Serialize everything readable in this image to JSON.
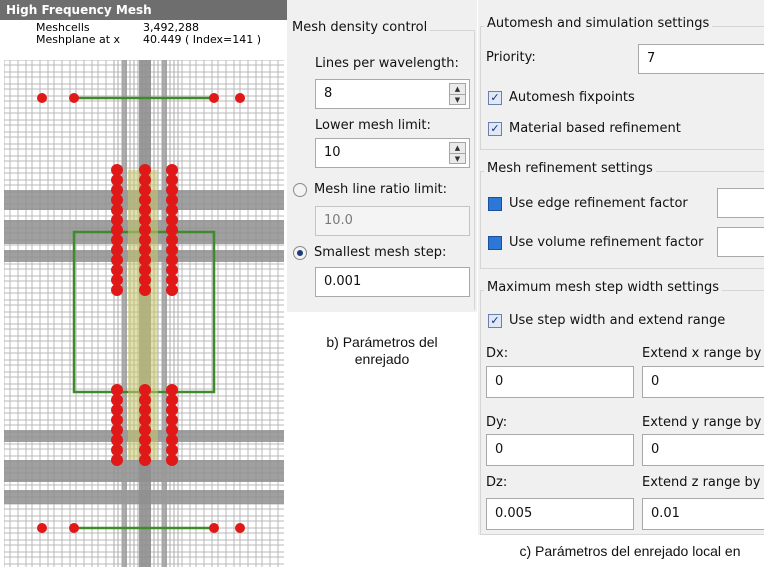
{
  "mesh_panel": {
    "title": "High Frequency Mesh",
    "meshcells_label": "Meshcells",
    "meshcells_value": "3,492,288",
    "meshplane_label": "Meshplane at x",
    "meshplane_value": "40.449 ( Index=141 )"
  },
  "mesh_density": {
    "title": "Mesh density control",
    "lines_per_wavelength_label": "Lines per wavelength:",
    "lines_per_wavelength_value": "8",
    "lower_mesh_limit_label": "Lower mesh limit:",
    "lower_mesh_limit_value": "10",
    "mesh_line_ratio_label": "Mesh line ratio limit:",
    "mesh_line_ratio_value": "10.0",
    "smallest_mesh_step_label": "Smallest mesh step:",
    "smallest_mesh_step_value": "0.001"
  },
  "caption_b": "b) Parámetros del\nenrejado",
  "automesh": {
    "title": "Automesh and simulation settings",
    "priority_label": "Priority:",
    "priority_value": "7",
    "automesh_fixpoints_label": "Automesh fixpoints",
    "material_refinement_label": "Material based refinement"
  },
  "refinement": {
    "title": "Mesh refinement settings",
    "edge_label": "Use edge refinement factor",
    "volume_label": "Use volume refinement factor"
  },
  "max_step": {
    "title": "Maximum mesh step width settings",
    "use_step_label": "Use step width and extend range",
    "dx_label": "Dx:",
    "dx_value": "0",
    "ext_x_label": "Extend x range by",
    "ext_x_value": "0",
    "dy_label": "Dy:",
    "dy_value": "0",
    "ext_y_label": "Extend y range by",
    "ext_y_value": "0",
    "dz_label": "Dz:",
    "dz_value": "0.005",
    "ext_z_label": "Extend z range by",
    "ext_z_value": "0.01"
  },
  "caption_c": "c) Parámetros del enrejado local en"
}
